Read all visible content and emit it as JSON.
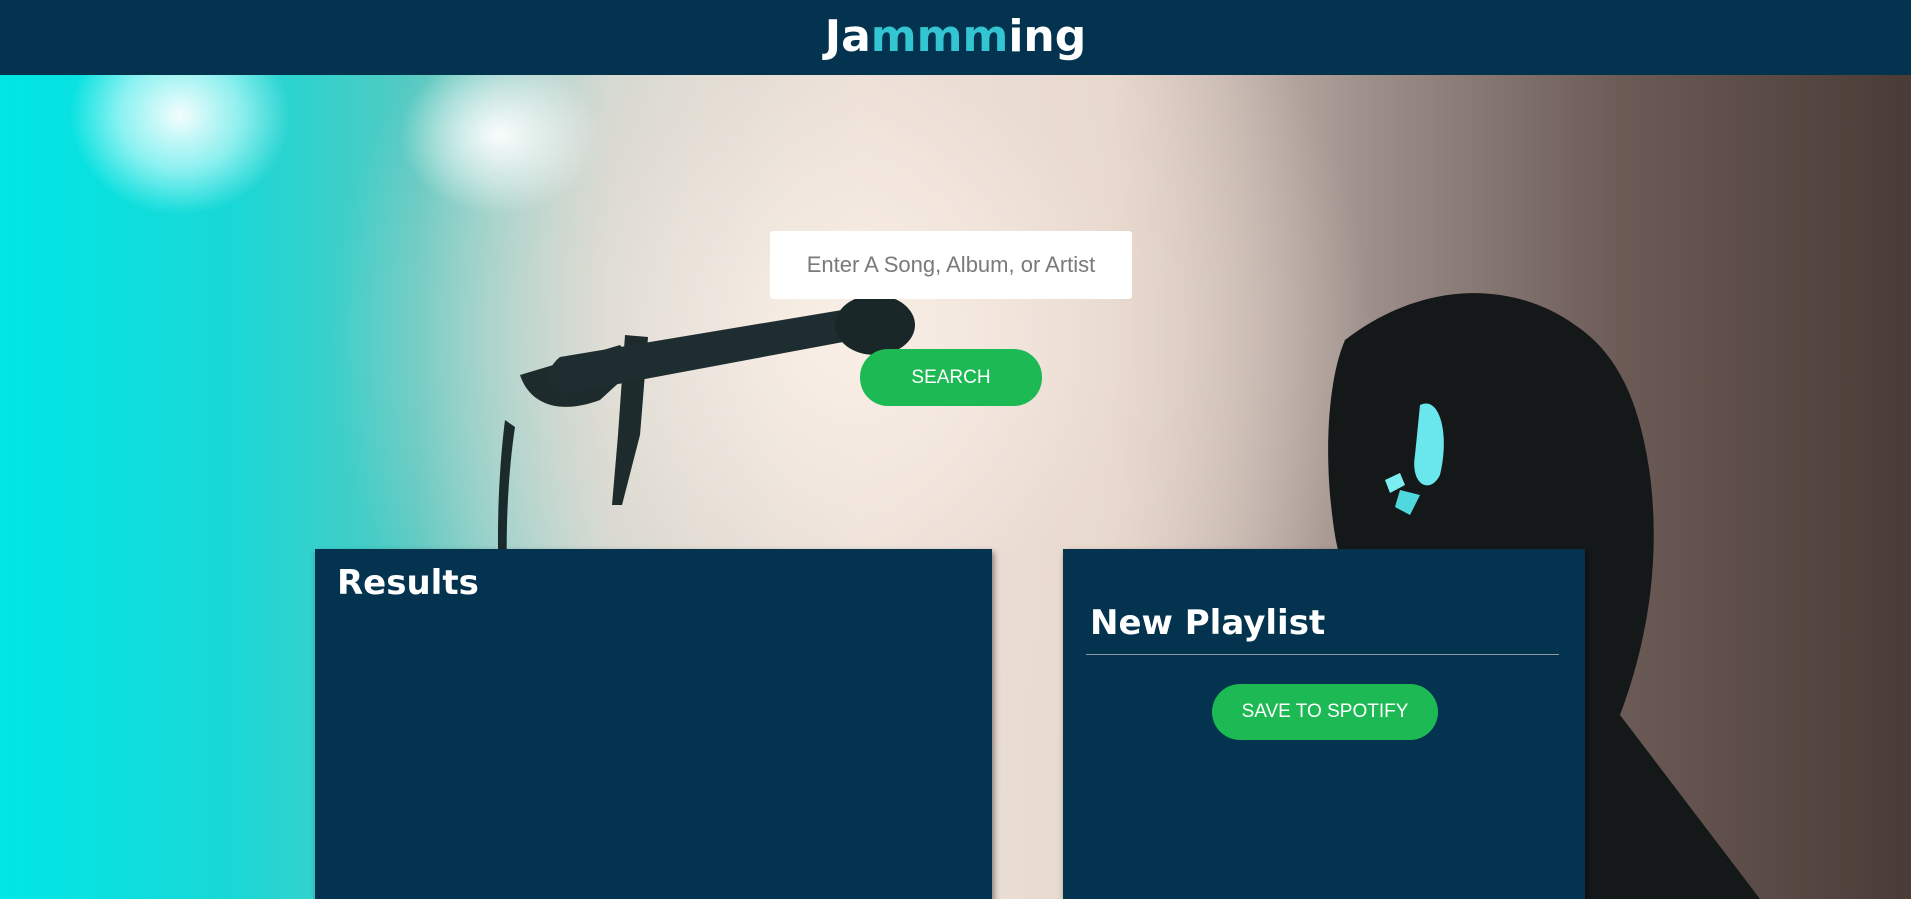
{
  "header": {
    "logo_prefix": "Ja",
    "logo_accent": "mmm",
    "logo_suffix": "ing"
  },
  "search": {
    "placeholder": "Enter A Song, Album, or Artist",
    "button_label": "SEARCH"
  },
  "results": {
    "title": "Results",
    "items": []
  },
  "playlist": {
    "title": "New Playlist",
    "save_label": "SAVE TO SPOTIFY",
    "tracks": []
  },
  "colors": {
    "header_bg": "#03334f",
    "accent": "#33c5d1",
    "button_green": "#1db954",
    "panel_bg": "#03334f"
  }
}
